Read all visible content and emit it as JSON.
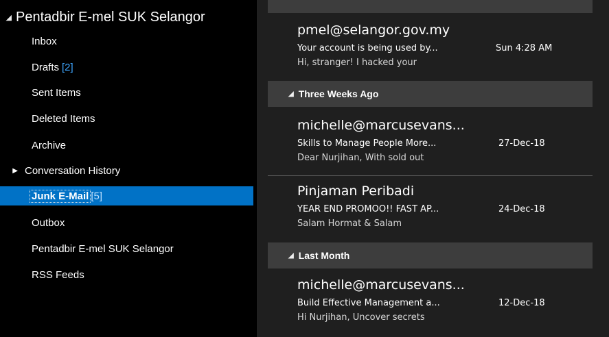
{
  "sidebar": {
    "account": "Pentadbir E-mel SUK Selangor",
    "folders": [
      {
        "label": "Inbox",
        "count": ""
      },
      {
        "label": "Drafts",
        "count": "[2]"
      },
      {
        "label": "Sent Items",
        "count": ""
      },
      {
        "label": "Deleted Items",
        "count": ""
      },
      {
        "label": "Archive",
        "count": ""
      },
      {
        "label": "Conversation History",
        "count": ""
      },
      {
        "label": "Junk E-Mail",
        "count": "[5]"
      },
      {
        "label": "Outbox",
        "count": ""
      },
      {
        "label": "Pentadbir E-mel SUK Selangor",
        "count": ""
      },
      {
        "label": "RSS Feeds",
        "count": ""
      }
    ],
    "selected_folder": "Junk E-Mail"
  },
  "messages": {
    "m0": {
      "sender": "pmel@selangor.gov.my",
      "subject": "Your account is being used by...",
      "date": "Sun 4:28 AM",
      "preview": "Hi, stranger!  I hacked your"
    },
    "group1": "Three Weeks Ago",
    "m1": {
      "sender": "michelle@marcusevans...",
      "subject": "Skills to Manage People More...",
      "date": "27-Dec-18",
      "preview": "Dear Nurjihan,  With sold out"
    },
    "m2": {
      "sender": "Pinjaman Peribadi",
      "subject": "YEAR END PROMOO!! FAST AP...",
      "date": "24-Dec-18",
      "preview": "Salam Hormat & Salam"
    },
    "group2": "Last Month",
    "m3": {
      "sender": "michelle@marcusevans...",
      "subject": "Build Effective Management a...",
      "date": "12-Dec-18",
      "preview": "Hi Nurjihan,  Uncover secrets"
    }
  }
}
